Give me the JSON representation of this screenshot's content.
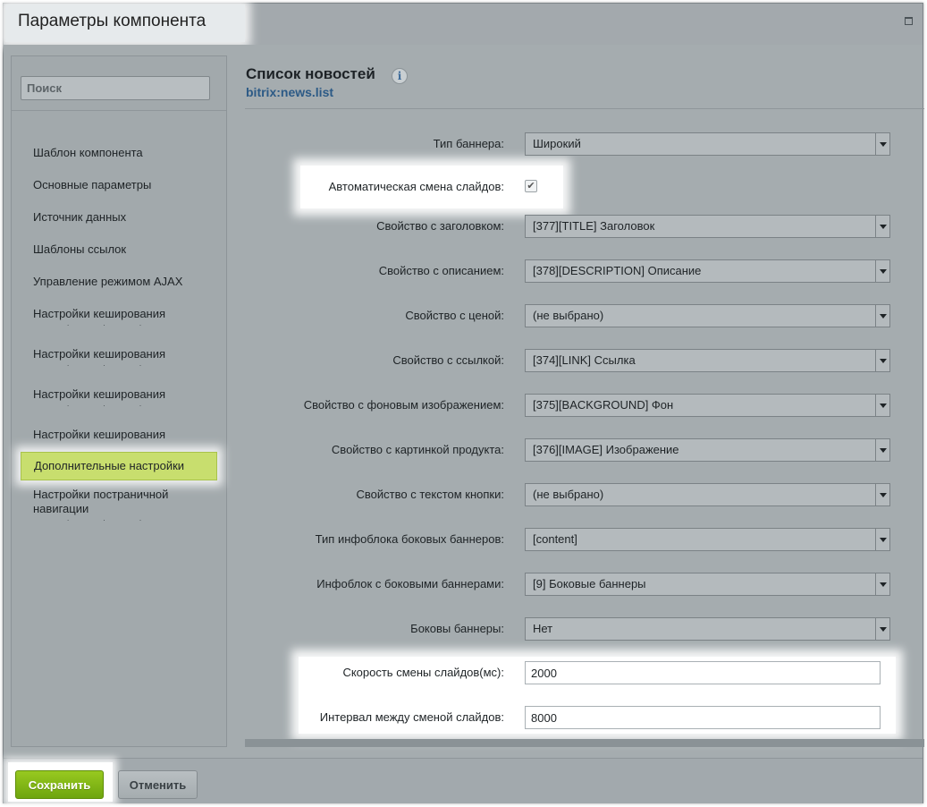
{
  "window": {
    "title": "Параметры компонента",
    "maximize_icon": "maximize-icon"
  },
  "sidebar": {
    "search_placeholder": "Поиск",
    "items": [
      {
        "label": "Шаблон компонента"
      },
      {
        "label": "Основные параметры"
      },
      {
        "label": "Источник данных"
      },
      {
        "label": "Шаблоны ссылок"
      },
      {
        "label": "Управление режимом AJAX"
      },
      {
        "label": "Настройки кеширования"
      },
      {
        "label": "Настройки кеширования"
      },
      {
        "label": "Настройки кеширования"
      },
      {
        "label": "Настройки кеширования"
      },
      {
        "label": "Дополнительные настройки",
        "active": true
      },
      {
        "label": "Настройки постраничной навигации"
      }
    ]
  },
  "component": {
    "title": "Список новостей",
    "info_icon": "info-icon",
    "code": "bitrix:news.list"
  },
  "params": {
    "banner_type": {
      "label": "Тип баннера:",
      "value": "Широкий"
    },
    "auto_slide": {
      "label": "Автоматическая смена слайдов:",
      "checked": true
    },
    "title_prop": {
      "label": "Свойство с заголовком:",
      "value": "[377][TITLE] Заголовок"
    },
    "desc_prop": {
      "label": "Свойство с описанием:",
      "value": "[378][DESCRIPTION] Описание"
    },
    "price_prop": {
      "label": "Свойство с ценой:",
      "value": "(не выбрано)"
    },
    "link_prop": {
      "label": "Свойство с ссылкой:",
      "value": "[374][LINK] Ссылка"
    },
    "bg_prop": {
      "label": "Свойство с фоновым изображением:",
      "value": "[375][BACKGROUND] Фон"
    },
    "img_prop": {
      "label": "Свойство с картинкой продукта:",
      "value": "[376][IMAGE] Изображение"
    },
    "btn_text_prop": {
      "label": "Свойство с текстом кнопки:",
      "value": "(не выбрано)"
    },
    "side_iblock_type": {
      "label": "Тип инфоблока боковых баннеров:",
      "value": "[content]"
    },
    "side_iblock": {
      "label": "Инфоблок с боковыми баннерами:",
      "value": "[9] Боковые баннеры"
    },
    "side_banners": {
      "label": "Боковы баннеры:",
      "value": "Нет"
    },
    "slide_speed": {
      "label": "Скорость смены слайдов(мс):",
      "value": "2000"
    },
    "slide_interval": {
      "label": "Интервал между сменой слайдов:",
      "value": "8000"
    }
  },
  "footer": {
    "save_label": "Сохранить",
    "cancel_label": "Отменить"
  },
  "colors": {
    "save_button": "#7db316",
    "active_sidebar": "#c8de6e",
    "component_code": "#2c5a86"
  }
}
